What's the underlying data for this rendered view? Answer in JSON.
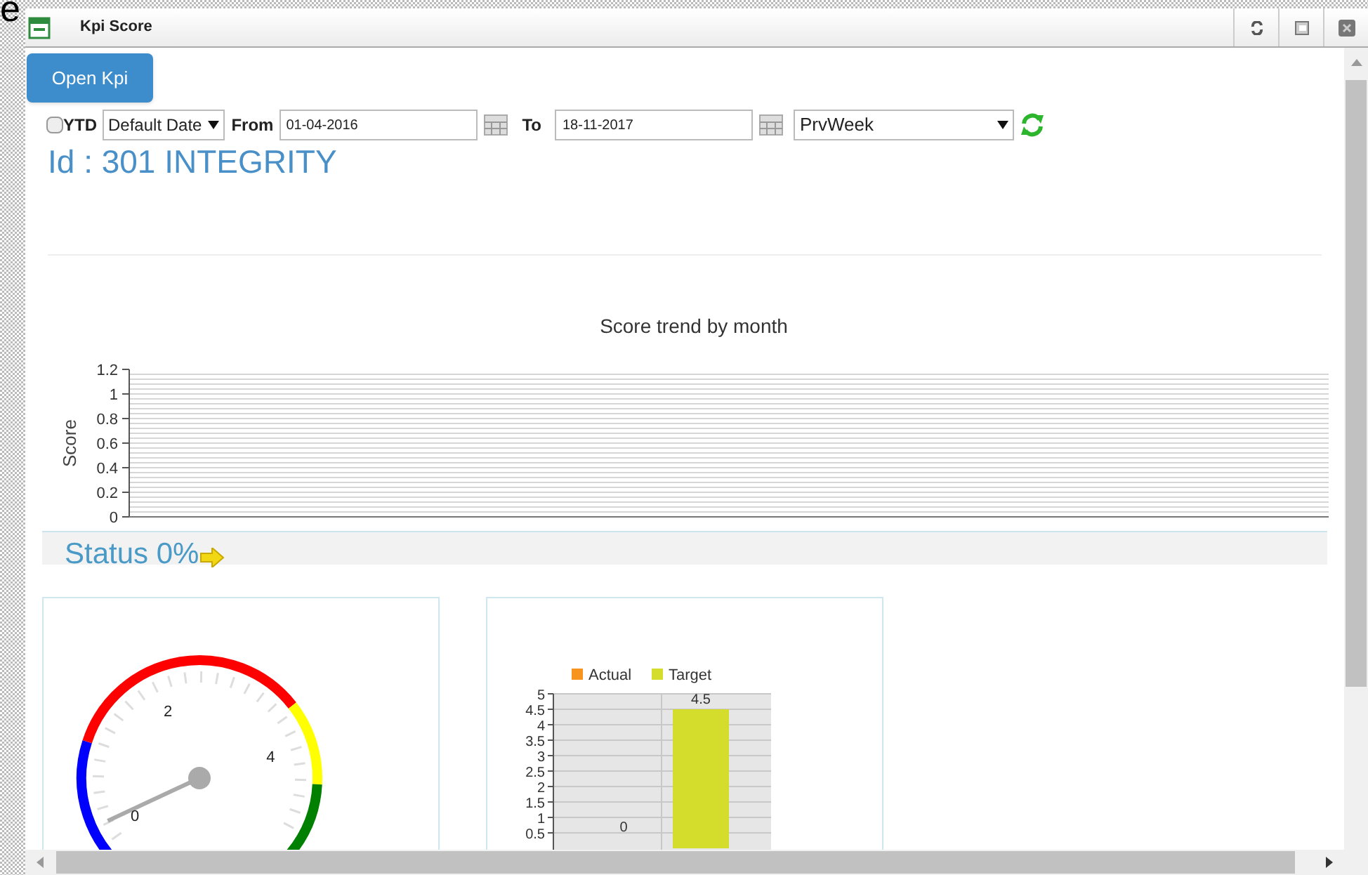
{
  "corner_text": "e",
  "window": {
    "title": "Kpi Score"
  },
  "open_button": {
    "label": "Open Kpi"
  },
  "filters": {
    "ytd": {
      "label": "YTD",
      "checked": false
    },
    "date_mode": {
      "value": "Default Date"
    },
    "from": {
      "label": "From",
      "value": "01-04-2016"
    },
    "to": {
      "label": "To",
      "value": "18-11-2017"
    },
    "period": {
      "value": "PrvWeek"
    }
  },
  "kpi_title": "Id : 301 INTEGRITY",
  "trend_chart": {
    "title": "Score trend by month",
    "axis_title": "Score",
    "axis_labels": [
      "1.2",
      "1",
      "0.8",
      "0.6",
      "0.4",
      "0.2",
      "0"
    ]
  },
  "status": {
    "label": "Status 0%"
  },
  "gauge": {
    "labels": [
      "0",
      "2",
      "4"
    ]
  },
  "bar_chart": {
    "chart_data": {
      "type": "bar",
      "series": [
        {
          "name": "Actual",
          "color": "#f7941d",
          "values": [
            0
          ]
        },
        {
          "name": "Target",
          "color": "#d4dc2c",
          "values": [
            4.5
          ]
        }
      ],
      "ylim": [
        0,
        5
      ],
      "yticks": [
        {
          "value": 0.5,
          "label": "0.5"
        },
        {
          "value": 1,
          "label": "1"
        },
        {
          "value": 1.5,
          "label": "1.5"
        },
        {
          "value": 2,
          "label": "2"
        },
        {
          "value": 2.5,
          "label": "2.5"
        },
        {
          "value": 3,
          "label": "3"
        },
        {
          "value": 3.5,
          "label": "3.5"
        },
        {
          "value": 4,
          "label": "4"
        },
        {
          "value": 4.5,
          "label": "4.5"
        },
        {
          "value": 5,
          "label": "5"
        }
      ],
      "value_labels": [
        "0",
        "4.5"
      ],
      "grid": true
    }
  }
}
